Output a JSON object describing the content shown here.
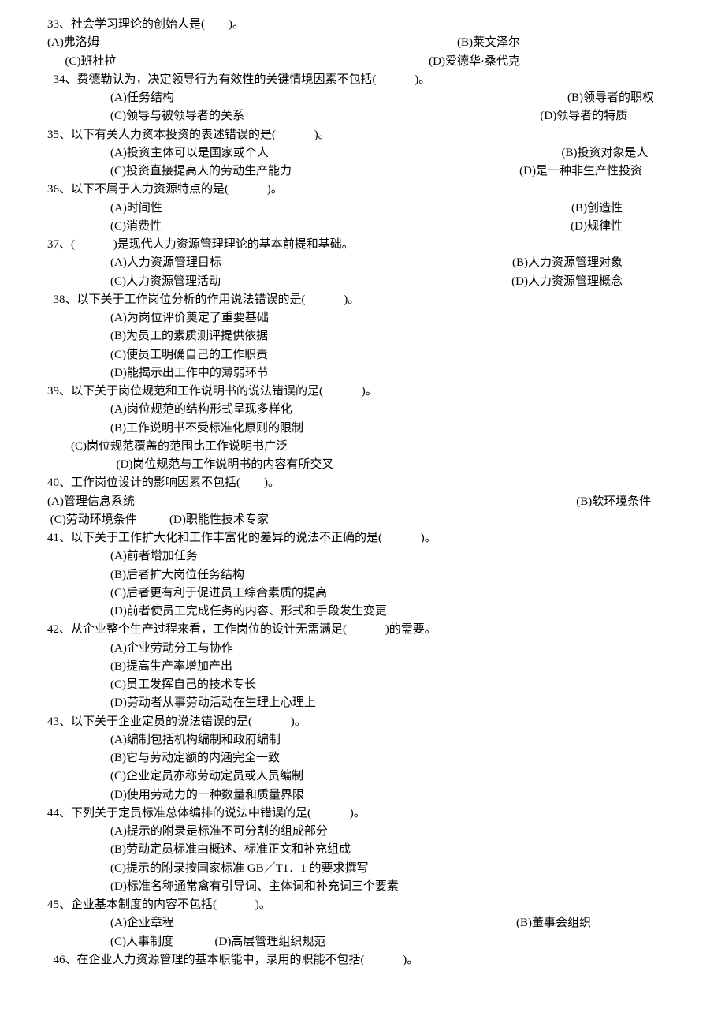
{
  "questions": [
    {
      "stem": "33、社会学习理论的创始人是(　　)。",
      "stemIndent": "indent0",
      "opts": [
        [
          {
            "t": "(A)弗洛姆",
            "cls": "flex1"
          },
          {
            "t": "(B)莱文泽尔",
            "cls": ""
          }
        ],
        [
          {
            "t": "      (C)班杜拉",
            "cls": "flex1"
          },
          {
            "t": "(D)爱德华·桑代克",
            "cls": ""
          }
        ]
      ],
      "optIndent": "indent0",
      "optRight": 200
    },
    {
      "stem": "  34、费德勒认为，决定领导行为有效性的关键情境因素不包括(　　　 )。",
      "stemIndent": "indent0",
      "opts": [
        [
          {
            "t": "(A)任务结构",
            "cls": "flex1"
          },
          {
            "t": "(B)领导者的职权        ",
            "cls": ""
          }
        ],
        [
          {
            "t": "(C)领导与被领导者的关系",
            "cls": "flex1"
          },
          {
            "t": "(D)领导者的特质                 ",
            "cls": ""
          }
        ]
      ],
      "optIndent": "indent2"
    },
    {
      "stem": "35、以下有关人力资本投资的表述错误的是(　　　 )。",
      "stemIndent": "indent0",
      "opts": [
        [
          {
            "t": "(A)投资主体可以是国家或个人",
            "cls": "flex1"
          },
          {
            "t": "(B)投资对象是人          ",
            "cls": ""
          }
        ],
        [
          {
            "t": "(C)投资直接提高人的劳动生产能力",
            "cls": "flex1"
          },
          {
            "t": "(D)是一种非生产性投资            ",
            "cls": ""
          }
        ]
      ],
      "optIndent": "indent2"
    },
    {
      "stem": "36、以下不属于人力资源特点的是(　　　 )。",
      "stemIndent": "indent0",
      "opts": [
        [
          {
            "t": "(A)时间性",
            "cls": "flex1"
          },
          {
            "t": "(B)创造性",
            "cls": ""
          }
        ],
        [
          {
            "t": "(C)消费性",
            "cls": "flex1"
          },
          {
            "t": "(D)规律性",
            "cls": ""
          }
        ]
      ],
      "optIndent": "indent2",
      "optRight": 70
    },
    {
      "stem": "37、(　　　 )是现代人力资源管理理论的基本前提和基础。",
      "stemIndent": "indent0",
      "opts": [
        [
          {
            "t": "(A)人力资源管理目标",
            "cls": "flex1"
          },
          {
            "t": "(B)人力资源管理对象",
            "cls": ""
          }
        ],
        [
          {
            "t": "(C)人力资源管理活动",
            "cls": "flex1"
          },
          {
            "t": "(D)人力资源管理概念",
            "cls": ""
          }
        ]
      ],
      "optIndent": "indent2",
      "optRight": 70
    },
    {
      "stem": "  38、以下关于工作岗位分析的作用说法错误的是(　　　 )。",
      "stemIndent": "indent0",
      "opts": [
        [
          {
            "t": "(A)为岗位评价奠定了重要基础",
            "cls": ""
          }
        ],
        [
          {
            "t": "(B)为员工的素质测评提供依据",
            "cls": ""
          }
        ],
        [
          {
            "t": "(C)使员工明确自己的工作职责",
            "cls": ""
          }
        ],
        [
          {
            "t": "(D)能揭示出工作中的薄弱环节",
            "cls": ""
          }
        ]
      ],
      "optIndent": "indent2"
    },
    {
      "stem": "39、以下关于岗位规范和工作说明书的说法错误的是(　　　 )。",
      "stemIndent": "indent0",
      "opts": [
        [
          {
            "t": "(A)岗位规范的结构形式呈现多样化",
            "cls": ""
          }
        ],
        [
          {
            "t": "(B)工作说明书不受标准化原则的限制",
            "cls": ""
          }
        ],
        [
          {
            "t": "(C)岗位规范覆盖的范围比工作说明书广泛",
            "cls": "",
            "outdent": true
          }
        ],
        [
          {
            "t": "  (D)岗位规范与工作说明书的内容有所交叉",
            "cls": ""
          }
        ]
      ],
      "optIndent": "indent2"
    },
    {
      "stem": "40、工作岗位设计的影响因素不包括(　　)。",
      "stemIndent": "indent0",
      "opts": [
        [
          {
            "t": "(A)管理信息系统",
            "cls": "flex1"
          },
          {
            "t": "(B)软环境条件         ",
            "cls": ""
          }
        ],
        [
          {
            "t": " (C)劳动环境条件           (D)职能性技术专家",
            "cls": ""
          }
        ]
      ],
      "optIndent": "indent0"
    },
    {
      "stem": "41、以下关于工作扩大化和工作丰富化的差异的说法不正确的是(　　　 )。",
      "stemIndent": "indent0",
      "opts": [
        [
          {
            "t": "(A)前者增加任务",
            "cls": ""
          }
        ],
        [
          {
            "t": "(B)后者扩大岗位任务结构",
            "cls": ""
          }
        ],
        [
          {
            "t": "(C)后者更有利于促进员工综合素质的提高",
            "cls": ""
          }
        ],
        [
          {
            "t": "(D)前者使员工完成任务的内容、形式和手段发生变更",
            "cls": ""
          }
        ]
      ],
      "optIndent": "indent2"
    },
    {
      "stem": "42、从企业整个生产过程来看，工作岗位的设计无需满足(　　　 )的需要。",
      "stemIndent": "indent0",
      "opts": [
        [
          {
            "t": "(A)企业劳动分工与协作",
            "cls": ""
          }
        ],
        [
          {
            "t": "(B)提高生产率增加产出",
            "cls": ""
          }
        ],
        [
          {
            "t": "(C)员工发挥自己的技术专长",
            "cls": ""
          }
        ],
        [
          {
            "t": "(D)劳动者从事劳动活动在生理上心理上",
            "cls": ""
          }
        ]
      ],
      "optIndent": "indent2"
    },
    {
      "stem": "43、以下关于企业定员的说法错误的是(　　　 )。",
      "stemIndent": "indent0",
      "opts": [
        [
          {
            "t": "(A)编制包括机构编制和政府编制",
            "cls": ""
          }
        ],
        [
          {
            "t": "(B)它与劳动定额的内涵完全一致",
            "cls": ""
          }
        ],
        [
          {
            "t": "(C)企业定员亦称劳动定员或人员编制",
            "cls": ""
          }
        ],
        [
          {
            "t": "(D)使用劳动力的一种数量和质量界限",
            "cls": ""
          }
        ]
      ],
      "optIndent": "indent2"
    },
    {
      "stem": "44、下列关于定员标准总体编排的说法中错误的是(　　　 )。",
      "stemIndent": "indent0",
      "opts": [
        [
          {
            "t": "(A)提示的附录是标准不可分割的组成部分",
            "cls": ""
          }
        ],
        [
          {
            "t": "(B)劳动定员标准由概述、标准正文和补充组成",
            "cls": ""
          }
        ],
        [
          {
            "t": "(C)提示的附录按国家标准 GB／T1．1 的要求撰写",
            "cls": ""
          }
        ],
        [
          {
            "t": "(D)标准名称通常禽有引导词、主体词和补充词三个要素",
            "cls": ""
          }
        ]
      ],
      "optIndent": "indent2"
    },
    {
      "stem": "45、企业基本制度的内容不包括(　　　 )。",
      "stemIndent": "indent0",
      "opts": [
        [
          {
            "t": "(A)企业章程",
            "cls": "flex1"
          },
          {
            "t": "(B)董事会组织",
            "cls": ""
          }
        ],
        [
          {
            "t": "(C)人事制度              (D)高层管理组织规范",
            "cls": ""
          }
        ]
      ],
      "optIndent": "indent2",
      "optRight": 110
    },
    {
      "stem": "  46、在企业人力资源管理的基本职能中，录用的职能不包括(　　　 )。",
      "stemIndent": "indent0",
      "opts": [],
      "optIndent": "indent0"
    }
  ]
}
